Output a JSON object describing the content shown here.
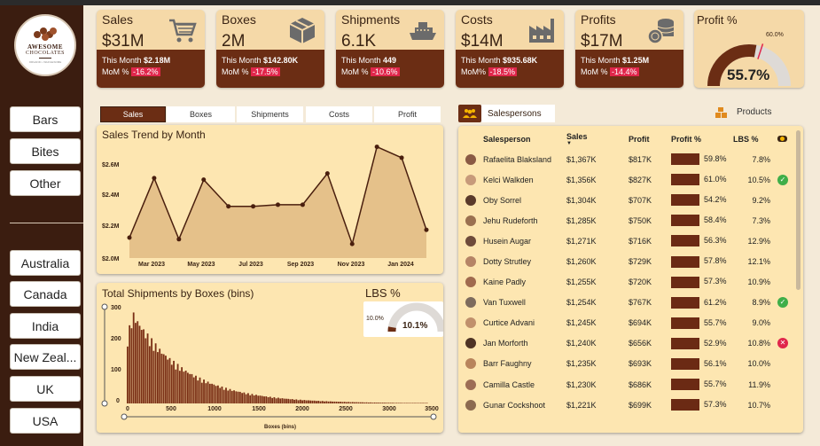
{
  "brand": {
    "line1": "AWESOME",
    "line2": "CHOCOLATES",
    "tagline": "ORGANIC • WHOLESOME"
  },
  "product_filters": [
    "Bars",
    "Bites",
    "Other"
  ],
  "country_filters": [
    "Australia",
    "Canada",
    "India",
    "New Zeal...",
    "UK",
    "USA"
  ],
  "kpis": [
    {
      "label": "Sales",
      "value": "$31M",
      "this_month_label": "This Month",
      "this_month": "$2.18M",
      "mom_label": "MoM %",
      "mom": "-16.2%",
      "icon": "cart-icon"
    },
    {
      "label": "Boxes",
      "value": "2M",
      "this_month_label": "This Month",
      "this_month": "$142.80K",
      "mom_label": "MoM %",
      "mom": "-17.5%",
      "icon": "box-icon"
    },
    {
      "label": "Shipments",
      "value": "6.1K",
      "this_month_label": "This Month",
      "this_month": "449",
      "mom_label": "MoM %",
      "mom": "-10.6%",
      "icon": "ship-icon"
    },
    {
      "label": "Costs",
      "value": "$14M",
      "this_month_label": "This Month",
      "this_month": "$935.68K",
      "mom_label": "MoM%",
      "mom": "-18.5%",
      "icon": "factory-icon"
    },
    {
      "label": "Profits",
      "value": "$17M",
      "this_month_label": "This Month",
      "this_month": "$1.25M",
      "mom_label": "MoM %",
      "mom": "-14.4%",
      "icon": "coins-icon"
    }
  ],
  "profit_pct": {
    "label": "Profit %",
    "value": "55.7%",
    "target": "60.0%",
    "fraction": 0.557,
    "target_fraction": 0.6
  },
  "metric_tabs": [
    "Sales",
    "Boxes",
    "Shipments",
    "Costs",
    "Profit"
  ],
  "active_tab": "Sales",
  "sales_trend": {
    "title": "Sales Trend by Month",
    "y_ticks": [
      "$2.6M",
      "$2.4M",
      "$2.2M",
      "$2.0M"
    ],
    "x_ticks": [
      "Mar 2023",
      "May 2023",
      "Jul 2023",
      "Sep 2023",
      "Nov 2023",
      "Jan 2024"
    ]
  },
  "chart_data": {
    "type": "area",
    "title": "Sales Trend by Month",
    "xlabel": "",
    "ylabel": "",
    "x": [
      "Feb 2023",
      "Mar 2023",
      "Apr 2023",
      "May 2023",
      "Jun 2023",
      "Jul 2023",
      "Aug 2023",
      "Sep 2023",
      "Oct 2023",
      "Nov 2023",
      "Dec 2023",
      "Jan 2024",
      "Feb 2024"
    ],
    "series": [
      {
        "values": [
          2.13,
          2.51,
          2.12,
          2.5,
          2.33,
          2.33,
          2.34,
          2.34,
          2.54,
          2.09,
          2.71,
          2.64,
          2.18
        ]
      }
    ],
    "ylim": [
      2.0,
      2.6
    ],
    "y_unit": "$M"
  },
  "histogram": {
    "title": "Total Shipments by Boxes (bins)",
    "y_ticks": [
      "300",
      "200",
      "100",
      "0"
    ],
    "x_ticks": [
      "0",
      "500",
      "1000",
      "1500",
      "2000",
      "2500",
      "3000",
      "3500"
    ],
    "xlabel": "Boxes (bins)",
    "ymax": 300,
    "xmax": 3500
  },
  "lbs": {
    "label": "LBS %",
    "value": "10.1%",
    "target": "10.0%",
    "fraction": 0.101
  },
  "table": {
    "tab_sales": "Salespersons",
    "tab_products": "Products",
    "headers": [
      "Salesperson",
      "Sales",
      "Profit",
      "Profit %",
      "LBS %"
    ],
    "rows": [
      {
        "name": "Rafaelita Blaksland",
        "sales": "$1,367K",
        "profit": "$817K",
        "pct": "59.8%",
        "pct_v": 59.8,
        "lbs": "7.8%",
        "status": ""
      },
      {
        "name": "Kelci Walkden",
        "sales": "$1,356K",
        "profit": "$827K",
        "pct": "61.0%",
        "pct_v": 61.0,
        "lbs": "10.5%",
        "status": "ok"
      },
      {
        "name": "Oby Sorrel",
        "sales": "$1,304K",
        "profit": "$707K",
        "pct": "54.2%",
        "pct_v": 54.2,
        "lbs": "9.2%",
        "status": ""
      },
      {
        "name": "Jehu Rudeforth",
        "sales": "$1,285K",
        "profit": "$750K",
        "pct": "58.4%",
        "pct_v": 58.4,
        "lbs": "7.3%",
        "status": ""
      },
      {
        "name": "Husein Augar",
        "sales": "$1,271K",
        "profit": "$716K",
        "pct": "56.3%",
        "pct_v": 56.3,
        "lbs": "12.9%",
        "status": ""
      },
      {
        "name": "Dotty Strutley",
        "sales": "$1,260K",
        "profit": "$729K",
        "pct": "57.8%",
        "pct_v": 57.8,
        "lbs": "12.1%",
        "status": ""
      },
      {
        "name": "Kaine Padly",
        "sales": "$1,255K",
        "profit": "$720K",
        "pct": "57.3%",
        "pct_v": 57.3,
        "lbs": "10.9%",
        "status": ""
      },
      {
        "name": "Van Tuxwell",
        "sales": "$1,254K",
        "profit": "$767K",
        "pct": "61.2%",
        "pct_v": 61.2,
        "lbs": "8.9%",
        "status": "ok"
      },
      {
        "name": "Curtice Advani",
        "sales": "$1,245K",
        "profit": "$694K",
        "pct": "55.7%",
        "pct_v": 55.7,
        "lbs": "9.0%",
        "status": ""
      },
      {
        "name": "Jan Morforth",
        "sales": "$1,240K",
        "profit": "$656K",
        "pct": "52.9%",
        "pct_v": 52.9,
        "lbs": "10.8%",
        "status": "bad"
      },
      {
        "name": "Barr Faughny",
        "sales": "$1,235K",
        "profit": "$693K",
        "pct": "56.1%",
        "pct_v": 56.1,
        "lbs": "10.0%",
        "status": ""
      },
      {
        "name": "Camilla Castle",
        "sales": "$1,230K",
        "profit": "$686K",
        "pct": "55.7%",
        "pct_v": 55.7,
        "lbs": "11.9%",
        "status": ""
      },
      {
        "name": "Gunar Cockshoot",
        "sales": "$1,221K",
        "profit": "$699K",
        "pct": "57.3%",
        "pct_v": 57.3,
        "lbs": "10.7%",
        "status": ""
      }
    ]
  },
  "colors": {
    "bg": "#f4ead8",
    "sidebar": "#3b1d10",
    "card": "#f5d9a8",
    "accent": "#6b2d14",
    "negative": "#e0264b",
    "ok": "#3fae49",
    "bad": "#e0264b"
  }
}
